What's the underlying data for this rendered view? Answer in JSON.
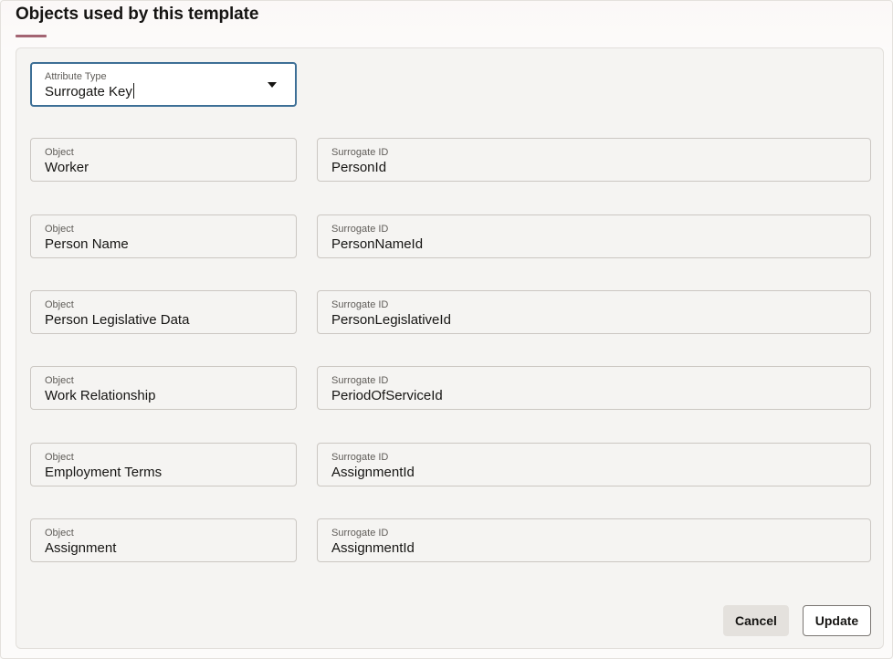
{
  "page": {
    "title": "Objects used by this template"
  },
  "attribute_type": {
    "label": "Attribute Type",
    "value": "Surrogate Key"
  },
  "rows": [
    {
      "object_label": "Object",
      "object_value": "Worker",
      "id_label": "Surrogate ID",
      "id_value": "PersonId"
    },
    {
      "object_label": "Object",
      "object_value": "Person Name",
      "id_label": "Surrogate ID",
      "id_value": "PersonNameId"
    },
    {
      "object_label": "Object",
      "object_value": "Person Legislative Data",
      "id_label": "Surrogate ID",
      "id_value": "PersonLegislativeId"
    },
    {
      "object_label": "Object",
      "object_value": "Work Relationship",
      "id_label": "Surrogate ID",
      "id_value": "PeriodOfServiceId"
    },
    {
      "object_label": "Object",
      "object_value": "Employment Terms",
      "id_label": "Surrogate ID",
      "id_value": "AssignmentId"
    },
    {
      "object_label": "Object",
      "object_value": "Assignment",
      "id_label": "Surrogate ID",
      "id_value": "AssignmentId"
    }
  ],
  "actions": {
    "cancel_label": "Cancel",
    "update_label": "Update"
  },
  "colors": {
    "accent_underline": "#a36472",
    "focus_border": "#3d6f96"
  },
  "icons": {
    "dropdown": "chevron-down-icon"
  }
}
